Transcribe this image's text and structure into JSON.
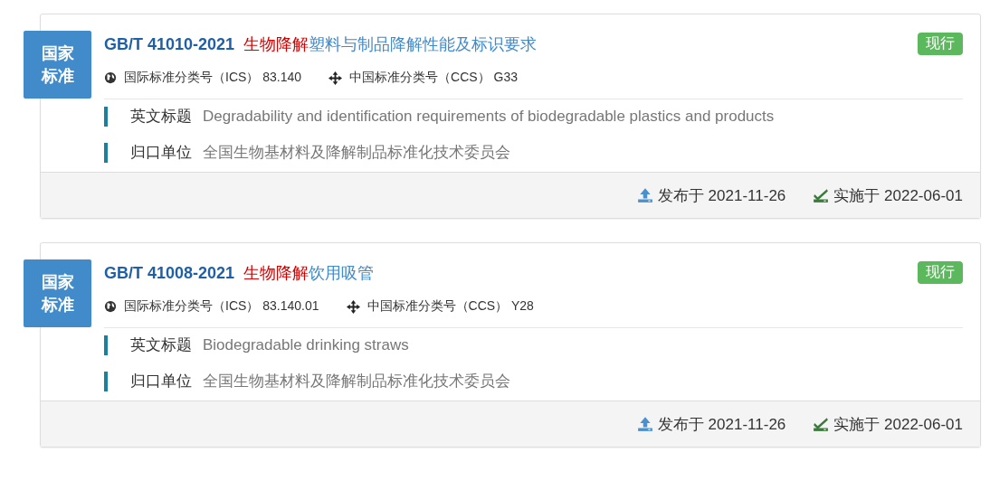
{
  "standards": [
    {
      "badge": "国家标准",
      "code": "GB/T 41010-2021",
      "title_highlight": "生物降解",
      "title_rest": "塑料与制品降解性能及标识要求",
      "status": "现行",
      "ics_label": "国际标准分类号（ICS）",
      "ics": "83.140",
      "ccs_label": "中国标准分类号（CCS）",
      "ccs": "G33",
      "fields": [
        {
          "label": "英文标题",
          "value": "Degradability and identification requirements of biodegradable plastics and products"
        },
        {
          "label": "归口单位",
          "value": "全国生物基材料及降解制品标准化技术委员会"
        }
      ],
      "published": "发布于 2021-11-26",
      "effective": "实施于 2022-06-01"
    },
    {
      "badge": "国家标准",
      "code": "GB/T 41008-2021",
      "title_highlight": "生物降解",
      "title_rest": "饮用吸管",
      "status": "现行",
      "ics_label": "国际标准分类号（ICS）",
      "ics": "83.140.01",
      "ccs_label": "中国标准分类号（CCS）",
      "ccs": "Y28",
      "fields": [
        {
          "label": "英文标题",
          "value": "Biodegradable drinking straws"
        },
        {
          "label": "归口单位",
          "value": "全国生物基材料及降解制品标准化技术委员会"
        }
      ],
      "published": "发布于 2021-11-26",
      "effective": "实施于 2022-06-01"
    }
  ]
}
